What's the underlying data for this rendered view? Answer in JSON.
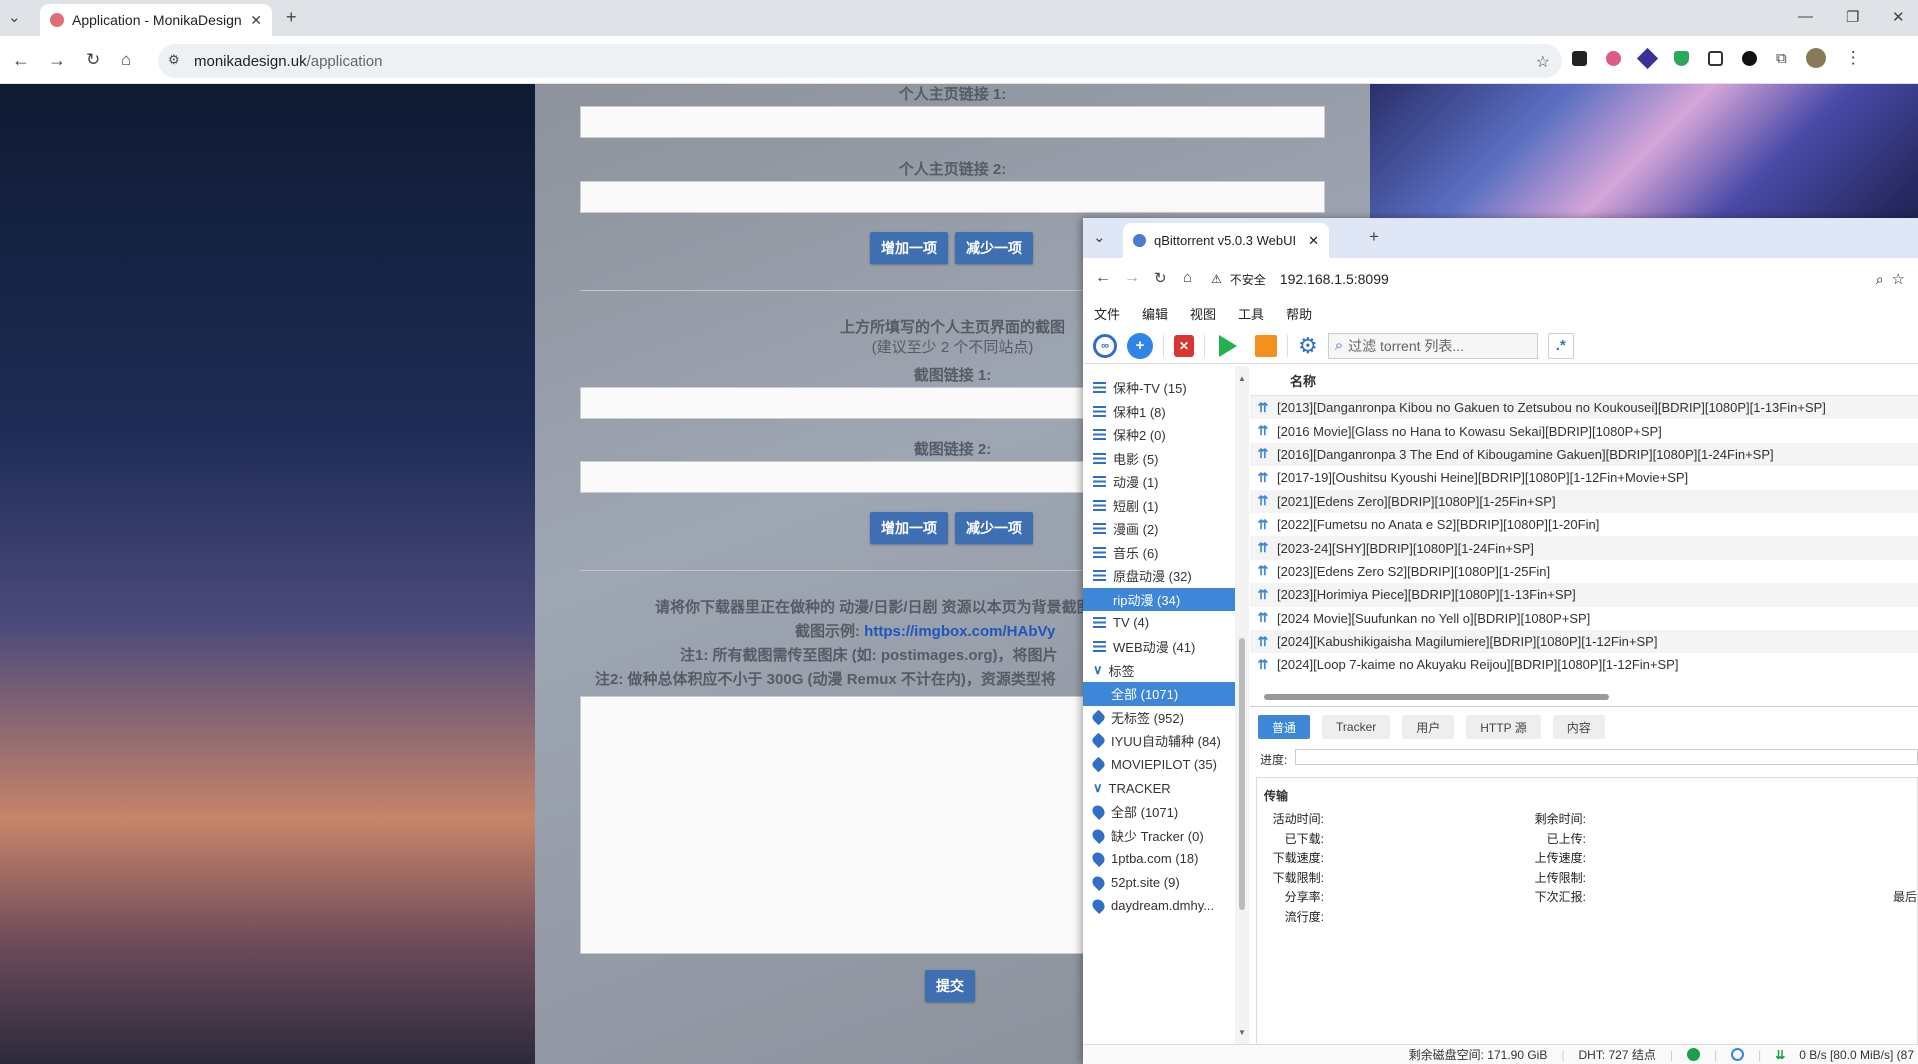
{
  "browser": {
    "tab_title": "Application - MonikaDesign",
    "url_domain": "monikadesign.uk",
    "url_path": "/application"
  },
  "form": {
    "label_homepage1": "个人主页链接 1:",
    "label_homepage2": "个人主页链接 2:",
    "add_label": "增加一项",
    "remove_label": "减少一项",
    "screenshot_title": "上方所填写的个人主页界面的截图",
    "screenshot_hint": "(建议至少 2 个不同站点)",
    "label_shot1": "截图链接 1:",
    "label_shot2": "截图链接 2:",
    "note_main": "请将你下载器里正在做种的 动漫/日影/日剧 资源以本页为背景截图",
    "note_example_prefix": "截图示例:",
    "note_example_link": "https://imgbox.com/HAbVy",
    "note1": "注1: 所有截图需传至图床 (如: postimages.org)，将图片",
    "note2": "注2: 做种总体积应不小于 300G (动漫 Remux 不计在内)，资源类型将",
    "submit_label": "提交"
  },
  "qb": {
    "tab_title": "qBittorrent v5.0.3 WebUI",
    "insecure_label": "不安全",
    "url": "192.168.1.5:8099",
    "menu": [
      "文件",
      "编辑",
      "视图",
      "工具",
      "帮助"
    ],
    "filter_placeholder": "过滤 torrent 列表...",
    "categories": [
      {
        "label": "保种-TV (15)"
      },
      {
        "label": "保种1 (8)"
      },
      {
        "label": "保种2 (0)"
      },
      {
        "label": "电影 (5)"
      },
      {
        "label": "动漫 (1)"
      },
      {
        "label": "短剧 (1)"
      },
      {
        "label": "漫画 (2)"
      },
      {
        "label": "音乐 (6)"
      },
      {
        "label": "原盘动漫 (32)"
      },
      {
        "label": "rip动漫 (34)"
      },
      {
        "label": "TV (4)"
      },
      {
        "label": "WEB动漫 (41)"
      }
    ],
    "tags_header": "标签",
    "tags": [
      {
        "label": "全部 (1071)"
      },
      {
        "label": "无标签 (952)"
      },
      {
        "label": "IYUU自动辅种 (84)"
      },
      {
        "label": "MOVIEPILOT (35)"
      }
    ],
    "tracker_header": "TRACKER",
    "trackers": [
      {
        "label": "全部 (1071)"
      },
      {
        "label": "缺少 Tracker (0)"
      },
      {
        "label": "1ptba.com (18)"
      },
      {
        "label": "52pt.site (9)"
      },
      {
        "label": "daydream.dmhy..."
      }
    ],
    "list_header": "名称",
    "torrents": [
      "[2013][Danganronpa Kibou no Gakuen to Zetsubou no Koukousei][BDRIP][1080P][1-13Fin+SP]",
      "[2016 Movie][Glass no Hana to Kowasu Sekai][BDRIP][1080P+SP]",
      "[2016][Danganronpa 3 The End of Kibougamine Gakuen][BDRIP][1080P][1-24Fin+SP]",
      "[2017-19][Oushitsu Kyoushi Heine][BDRIP][1080P][1-12Fin+Movie+SP]",
      "[2021][Edens Zero][BDRIP][1080P][1-25Fin+SP]",
      "[2022][Fumetsu no Anata e S2][BDRIP][1080P][1-20Fin]",
      "[2023-24][SHY][BDRIP][1080P][1-24Fin+SP]",
      "[2023][Edens Zero S2][BDRIP][1080P][1-25Fin]",
      "[2023][Horimiya Piece][BDRIP][1080P][1-13Fin+SP]",
      "[2024 Movie][Suufunkan no Yell o][BDRIP][1080P+SP]",
      "[2024][Kabushikigaisha Magilumiere][BDRIP][1080P][1-12Fin+SP]",
      "[2024][Loop 7-kaime no Akuyaku Reijou][BDRIP][1080P][1-12Fin+SP]"
    ],
    "prop_tabs": [
      "普通",
      "Tracker",
      "用户",
      "HTTP 源",
      "内容"
    ],
    "progress_label": "进度:",
    "transfer_header": "传输",
    "transfer_left": [
      "活动时间:",
      "已下载:",
      "下载速度:",
      "下载限制:",
      "分享率:",
      "流行度:"
    ],
    "transfer_right": [
      "剩余时间:",
      "已上传:",
      "上传速度:",
      "上传限制:",
      "下次汇报:"
    ],
    "transfer_far": "最后",
    "status_disk": "剩余磁盘空间: 171.90 GiB",
    "status_dht": "DHT: 727 结点",
    "status_speed": "0 B/s [80.0 MiB/s] (87"
  }
}
